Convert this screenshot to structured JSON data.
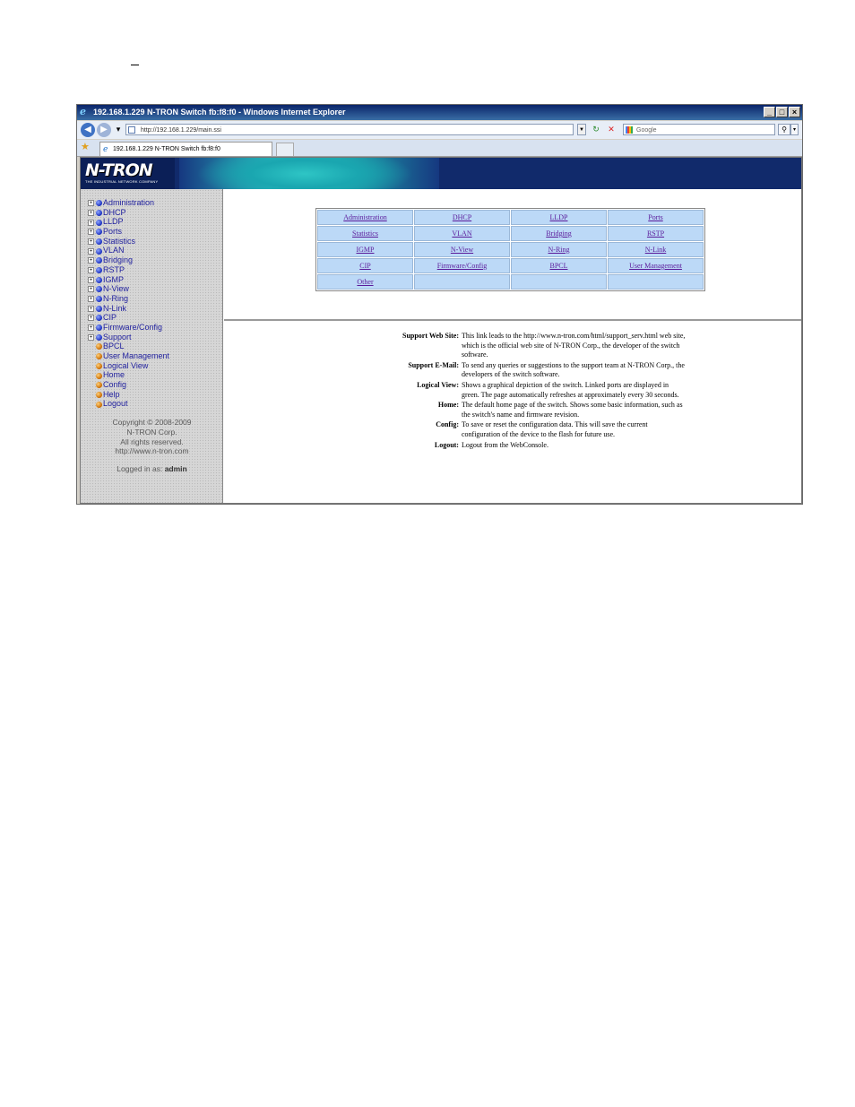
{
  "window": {
    "title": "192.168.1.229 N-TRON Switch fb:f8:f0 - Windows Internet Explorer",
    "min_glyph": "_",
    "max_glyph": "□",
    "close_glyph": "×"
  },
  "addressbar": {
    "url": "http://192.168.1.229/main.ssi",
    "search_placeholder": "Google"
  },
  "tab": {
    "label": "192.168.1.229 N-TRON Switch fb:f8:f0"
  },
  "banner": {
    "logo": "N-TRON",
    "tagline": "THE INDUSTRIAL NETWORK COMPANY"
  },
  "nav": {
    "items": [
      {
        "label": "Administration",
        "expandable": true,
        "dot": "blue"
      },
      {
        "label": "DHCP",
        "expandable": true,
        "dot": "blue"
      },
      {
        "label": "LLDP",
        "expandable": true,
        "dot": "blue"
      },
      {
        "label": "Ports",
        "expandable": true,
        "dot": "blue"
      },
      {
        "label": "Statistics",
        "expandable": true,
        "dot": "blue"
      },
      {
        "label": "VLAN",
        "expandable": true,
        "dot": "blue"
      },
      {
        "label": "Bridging",
        "expandable": true,
        "dot": "blue"
      },
      {
        "label": "RSTP",
        "expandable": true,
        "dot": "blue"
      },
      {
        "label": "IGMP",
        "expandable": true,
        "dot": "blue"
      },
      {
        "label": "N-View",
        "expandable": true,
        "dot": "blue"
      },
      {
        "label": "N-Ring",
        "expandable": true,
        "dot": "blue"
      },
      {
        "label": "N-Link",
        "expandable": true,
        "dot": "blue"
      },
      {
        "label": "CIP",
        "expandable": true,
        "dot": "blue"
      },
      {
        "label": "Firmware/Config",
        "expandable": true,
        "dot": "blue"
      },
      {
        "label": "Support",
        "expandable": true,
        "dot": "blue"
      },
      {
        "label": "BPCL",
        "expandable": false,
        "dot": "orange"
      },
      {
        "label": "User Management",
        "expandable": false,
        "dot": "orange"
      },
      {
        "label": "Logical View",
        "expandable": false,
        "dot": "orange"
      },
      {
        "label": "Home",
        "expandable": false,
        "dot": "orange"
      },
      {
        "label": "Config",
        "expandable": false,
        "dot": "orange"
      },
      {
        "label": "Help",
        "expandable": false,
        "dot": "orange"
      },
      {
        "label": "Logout",
        "expandable": false,
        "dot": "orange"
      }
    ],
    "footer": {
      "copyright": "Copyright © 2008-2009",
      "company": "N-TRON Corp.",
      "rights": "All rights reserved.",
      "website": "http://www.n-tron.com",
      "logged_in_label": "Logged in as:",
      "user": "admin"
    }
  },
  "menu_table": {
    "rows": [
      [
        "Administration",
        "DHCP",
        "LLDP",
        "Ports"
      ],
      [
        "Statistics",
        "VLAN",
        "Bridging",
        "RSTP"
      ],
      [
        "IGMP",
        "N-View",
        "N-Ring",
        "N-Link"
      ],
      [
        "CIP",
        "Firmware/Config",
        "BPCL",
        "User Management"
      ],
      [
        "Other",
        "",
        "",
        ""
      ]
    ]
  },
  "help": [
    {
      "term": "Support Web Site:",
      "desc": "This link leads to the http://www.n-tron.com/html/support_serv.html web site, which is the official web site of N-TRON Corp., the developer of the switch software."
    },
    {
      "term": "Support E-Mail:",
      "desc": "To send any queries or suggestions to the support team at N-TRON Corp., the developers of the switch software."
    },
    {
      "term": "Logical View:",
      "desc": "Shows a graphical depiction of the switch. Linked ports are displayed in green. The page automatically refreshes at approximately every 30 seconds."
    },
    {
      "term": "Home:",
      "desc": "The default home page of the switch. Shows some basic information, such as the switch's name and firmware revision."
    },
    {
      "term": "Config:",
      "desc": "To save or reset the configuration data. This will save the current configuration of the device to the flash for future use."
    },
    {
      "term": "Logout:",
      "desc": "Logout from the WebConsole."
    }
  ],
  "colors": {
    "banner": "#112a6b",
    "menu_cell": "#bcd9f7",
    "link": "#5a1a9a",
    "nav_text": "#1f1f9e"
  }
}
